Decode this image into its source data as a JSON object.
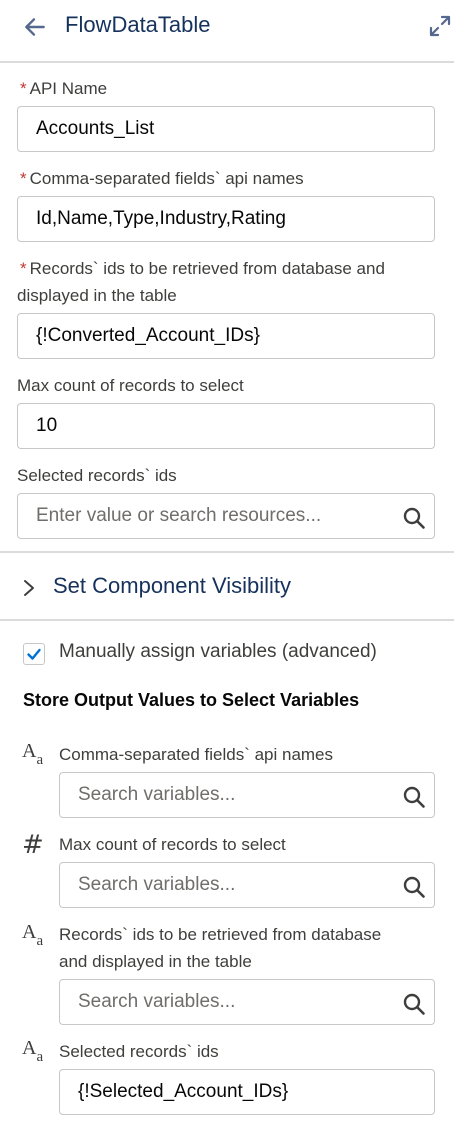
{
  "header": {
    "title": "FlowDataTable"
  },
  "fields": {
    "api_name": {
      "label": "API Name",
      "value": "Accounts_List"
    },
    "fields_api_names": {
      "label": "Comma-separated fields` api names",
      "value": "Id,Name,Type,Industry,Rating"
    },
    "record_ids": {
      "label_line1": "Records` ids to be retrieved from database and",
      "label_line2": "displayed in the table",
      "value": "{!Converted_Account_IDs}"
    },
    "max_count": {
      "label": "Max count of records to select",
      "value": "10"
    },
    "selected_ids": {
      "label": "Selected records` ids",
      "placeholder": "Enter value or search resources..."
    }
  },
  "visibility": {
    "title": "Set Component Visibility"
  },
  "manual_assign": {
    "label": "Manually assign variables (advanced)",
    "checked": true
  },
  "output": {
    "heading": "Store Output Values to Select Variables",
    "items": [
      {
        "label": "Comma-separated fields` api names",
        "placeholder": "Search variables...",
        "type_icon": "text-type-icon"
      },
      {
        "label": "Max count of records to select",
        "placeholder": "Search variables...",
        "type_icon": "number-type-icon"
      },
      {
        "label_line1": "Records` ids to be retrieved from database",
        "label_line2": "and displayed in the table",
        "placeholder": "Search variables...",
        "type_icon": "text-type-icon"
      },
      {
        "label": "Selected records` ids",
        "value": "{!Selected_Account_IDs}",
        "type_icon": "text-type-icon"
      }
    ]
  },
  "colors": {
    "accent": "#0070d2",
    "required": "#c23934",
    "title": "#16325c"
  }
}
